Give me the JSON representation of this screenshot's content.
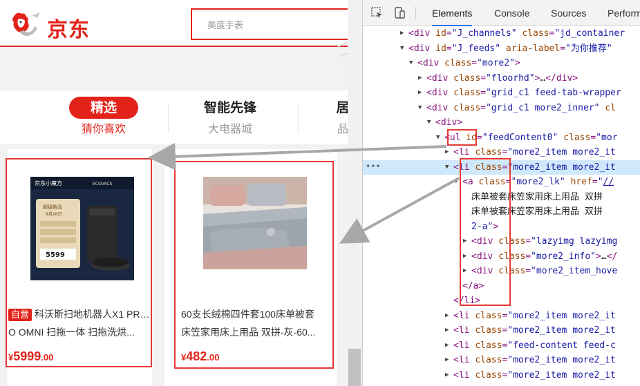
{
  "header": {
    "logo_text": "京东",
    "search_placeholder": "美度手表"
  },
  "tabs": [
    {
      "title": "精选",
      "subtitle": "猜你喜欢",
      "active": true
    },
    {
      "title": "智能先锋",
      "subtitle": "大电器城",
      "active": false
    },
    {
      "title": "居",
      "subtitle": "品",
      "active": false
    }
  ],
  "products": [
    {
      "badge": "自营",
      "title_line1": "科沃斯扫地机器人X1 PRO OMNI 扫拖一体 扫拖洗烘",
      "title_line2": "O OMNI 扫拖一体 扫拖洗烘...",
      "price_symbol": "¥",
      "price_int": "5999",
      "price_dec": ".00",
      "img_brand": "京东小魔方",
      "img_brand2": "ECOVACS",
      "img_label1": "超级新品",
      "img_label2": "9月26日",
      "img_price": "5599"
    },
    {
      "badge": "",
      "title_line1": "60支长绒棉四件套100床单被套",
      "title_line2": "床笠家用床上用品 双拼-灰-60...",
      "price_symbol": "¥",
      "price_int": "482",
      "price_dec": ".00"
    }
  ],
  "devtools": {
    "tabs": [
      "Elements",
      "Console",
      "Sources",
      "Perform"
    ],
    "active_tab": "Elements",
    "rows": [
      {
        "tri": "▶",
        "indent": 0,
        "html": "<span class=\"t-tag\">&lt;div</span> <span class=\"t-attr\">id</span>=<span class=\"t-val\">\"J_channels\"</span> <span class=\"t-attr\">class</span>=<span class=\"t-val\">\"jd_container</span>"
      },
      {
        "tri": "▼",
        "indent": 0,
        "html": "<span class=\"t-tag\">&lt;div</span> <span class=\"t-attr\">id</span>=<span class=\"t-val\">\"J_feeds\"</span> <span class=\"t-attr\">aria-label</span>=<span class=\"t-val\">\"为你推荐\"</span>"
      },
      {
        "tri": "▼",
        "indent": 1,
        "html": "<span class=\"t-tag\">&lt;div</span> <span class=\"t-attr\">class</span>=<span class=\"t-val\">\"more2\"</span><span class=\"t-tag\">&gt;</span>"
      },
      {
        "tri": "▶",
        "indent": 2,
        "html": "<span class=\"t-tag\">&lt;div</span> <span class=\"t-attr\">class</span>=<span class=\"t-val\">\"floorhd\"</span><span class=\"t-tag\">&gt;</span><span class=\"t-text\">…</span><span class=\"t-tag\">&lt;/div&gt;</span>"
      },
      {
        "tri": "▶",
        "indent": 2,
        "html": "<span class=\"t-tag\">&lt;div</span> <span class=\"t-attr\">class</span>=<span class=\"t-val\">\"grid_c1 feed-tab-wrapper</span>"
      },
      {
        "tri": "▼",
        "indent": 2,
        "html": "<span class=\"t-tag\">&lt;div</span> <span class=\"t-attr\">class</span>=<span class=\"t-val\">\"grid_c1 more2_inner\"</span> <span class=\"t-attr\">cl</span>"
      },
      {
        "tri": "▼",
        "indent": 3,
        "html": "<span class=\"t-tag\">&lt;div&gt;</span>"
      },
      {
        "tri": "▼",
        "indent": 4,
        "html": "<span class=\"t-tag\">&lt;ul</span> <span class=\"t-attr\">id</span>=<span class=\"t-val\">\"feedContent0\"</span> <span class=\"t-attr\">class</span>=<span class=\"t-val\">\"mor</span>"
      },
      {
        "tri": "▶",
        "indent": 5,
        "html": "<span class=\"t-tag\">&lt;li</span> <span class=\"t-attr\">class</span>=<span class=\"t-val\">\"more2_item more2_it</span>"
      },
      {
        "tri": "▼",
        "indent": 5,
        "sel": true,
        "html": "<span class=\"t-tag\">&lt;li</span> <span class=\"t-attr\">class</span>=<span class=\"t-val\">\"more2_item more2_it</span>"
      },
      {
        "tri": "▼",
        "indent": 6,
        "html": "<span class=\"t-tag\">&lt;a</span> <span class=\"t-attr\">class</span>=<span class=\"t-val\">\"more2_lk\"</span> <span class=\"t-attr\">href</span>=<span class=\"t-val\">\"<span class=\"t-link\">//</span></span>"
      },
      {
        "tri": "",
        "indent": 7,
        "html": "<span class=\"t-text\">床单被套床笠家用床上用品 双拼</span>"
      },
      {
        "tri": "",
        "indent": 7,
        "html": "<span class=\"t-text\">床单被套床笠家用床上用品 双拼</span>"
      },
      {
        "tri": "",
        "indent": 7,
        "html": "<span class=\"t-val\">2-a\"</span><span class=\"t-tag\">&gt;</span>"
      },
      {
        "tri": "▶",
        "indent": 7,
        "html": "<span class=\"t-tag\">&lt;div</span> <span class=\"t-attr\">class</span>=<span class=\"t-val\">\"lazyimg lazyimg</span>"
      },
      {
        "tri": "▶",
        "indent": 7,
        "html": "<span class=\"t-tag\">&lt;div</span> <span class=\"t-attr\">class</span>=<span class=\"t-val\">\"more2_info\"</span><span class=\"t-tag\">&gt;</span><span class=\"t-text\">…</span><span class=\"t-tag\">&lt;/</span>"
      },
      {
        "tri": "▶",
        "indent": 7,
        "html": "<span class=\"t-tag\">&lt;div</span> <span class=\"t-attr\">class</span>=<span class=\"t-val\">\"more2_item_hove</span>"
      },
      {
        "tri": "",
        "indent": 6,
        "html": "<span class=\"t-tag\">&lt;/a&gt;</span>"
      },
      {
        "tri": "",
        "indent": 5,
        "html": "<span class=\"t-tag\">&lt;/li&gt;</span>"
      },
      {
        "tri": "▶",
        "indent": 5,
        "html": "<span class=\"t-tag\">&lt;li</span> <span class=\"t-attr\">class</span>=<span class=\"t-val\">\"more2_item more2_it</span>"
      },
      {
        "tri": "▶",
        "indent": 5,
        "html": "<span class=\"t-tag\">&lt;li</span> <span class=\"t-attr\">class</span>=<span class=\"t-val\">\"more2_item more2_it</span>"
      },
      {
        "tri": "▶",
        "indent": 5,
        "html": "<span class=\"t-tag\">&lt;li</span> <span class=\"t-attr\">class</span>=<span class=\"t-val\">\"feed-content feed-c</span>"
      },
      {
        "tri": "▶",
        "indent": 5,
        "html": "<span class=\"t-tag\">&lt;li</span> <span class=\"t-attr\">class</span>=<span class=\"t-val\">\"more2_item more2_it</span>"
      },
      {
        "tri": "▶",
        "indent": 5,
        "html": "<span class=\"t-tag\">&lt;li</span> <span class=\"t-attr\">class</span>=<span class=\"t-val\">\"more2_item more2_it</span>"
      }
    ],
    "ellipsis": "•••"
  },
  "colors": {
    "brand_red": "#e2231a",
    "highlight_box": "#e53935",
    "selected_row": "#cfe8fc",
    "arrow": "#a8a8a8"
  }
}
